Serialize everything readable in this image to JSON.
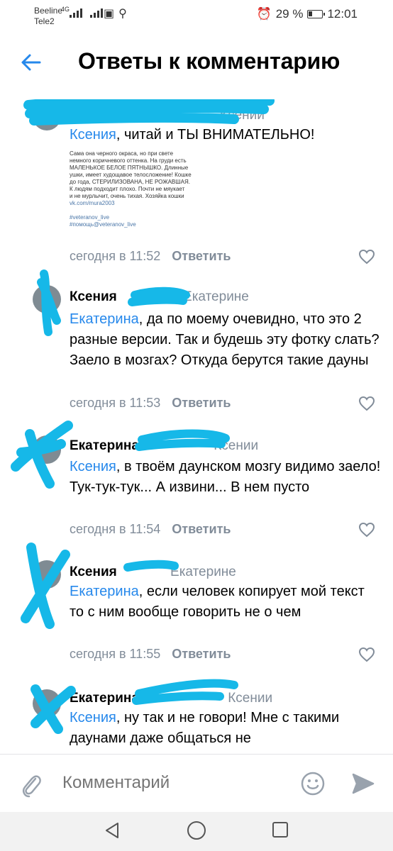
{
  "status_bar": {
    "carrier1": "Beeline",
    "carrier2": "Tele2",
    "network": "4G",
    "battery": "29 %",
    "time": "12:01",
    "battery_level": 0.29
  },
  "header": {
    "title": "Ответы к комментарию",
    "back_icon": "arrow-left-icon"
  },
  "comments": [
    {
      "author": "",
      "reply_to": "Ксении",
      "mention": "Ксения",
      "text": ", читай и ТЫ ВНИМАТЕЛЬНО!",
      "attachment": {
        "line1": "Сама она черного окраса, но при свете\nнемного коричневого оттенка. На груди есть\nМАЛЕНЬКОЕ БЕЛОЕ ПЯТНЫШКО. Длинные\nушки, имеет худощавое телосложение! Кошке\nдо года, СТЕРИЛИЗОВАНА, НЕ РОЖАВШАЯ.\nК людям подходит плохо. Почти не мяукает\nи не мурлычит, очень тихая. Хозяйка кошки",
        "link": "vk.com/mura2003",
        "tag1": "#veteranov_live",
        "tag2": "#помощь@veteranov_live"
      },
      "time": "сегодня в 11:52",
      "reply": "Ответить"
    },
    {
      "author": "Ксения",
      "reply_to": "Екатерине",
      "mention": "Екатерина",
      "text": ", да по моему очевидно, что это 2 разные версии. Так и будешь эту фотку слать? Заело в мозгах? Откуда берутся такие дауны",
      "time": "сегодня в 11:53",
      "reply": "Ответить"
    },
    {
      "author": "Екатерина",
      "reply_to": "Ксении",
      "mention": "Ксения",
      "text": ", в твоём даунском мозгу видимо заело! Тук-тук-тук... А извини... В нем пусто",
      "time": "сегодня в 11:54",
      "reply": "Ответить"
    },
    {
      "author": "Ксения",
      "reply_to": "Екатерине",
      "mention": "Екатерина",
      "text": ", если человек копирует  мой текст то с ним вообще говорить не о чем",
      "time": "сегодня в 11:55",
      "reply": "Ответить"
    },
    {
      "author": "Екатерина",
      "reply_to": "Ксении",
      "mention": "Ксения",
      "text": ", ну так и не говори! Мне с такими даунами даже общаться не",
      "time": "",
      "reply": ""
    }
  ],
  "composer": {
    "placeholder": "Комментарий",
    "attach_icon": "paperclip-icon",
    "emoji_icon": "smile-icon",
    "send_icon": "send-icon"
  },
  "colors": {
    "accent": "#2688eb",
    "secondary_text": "#818c99",
    "scribble": "#16b8e8"
  }
}
